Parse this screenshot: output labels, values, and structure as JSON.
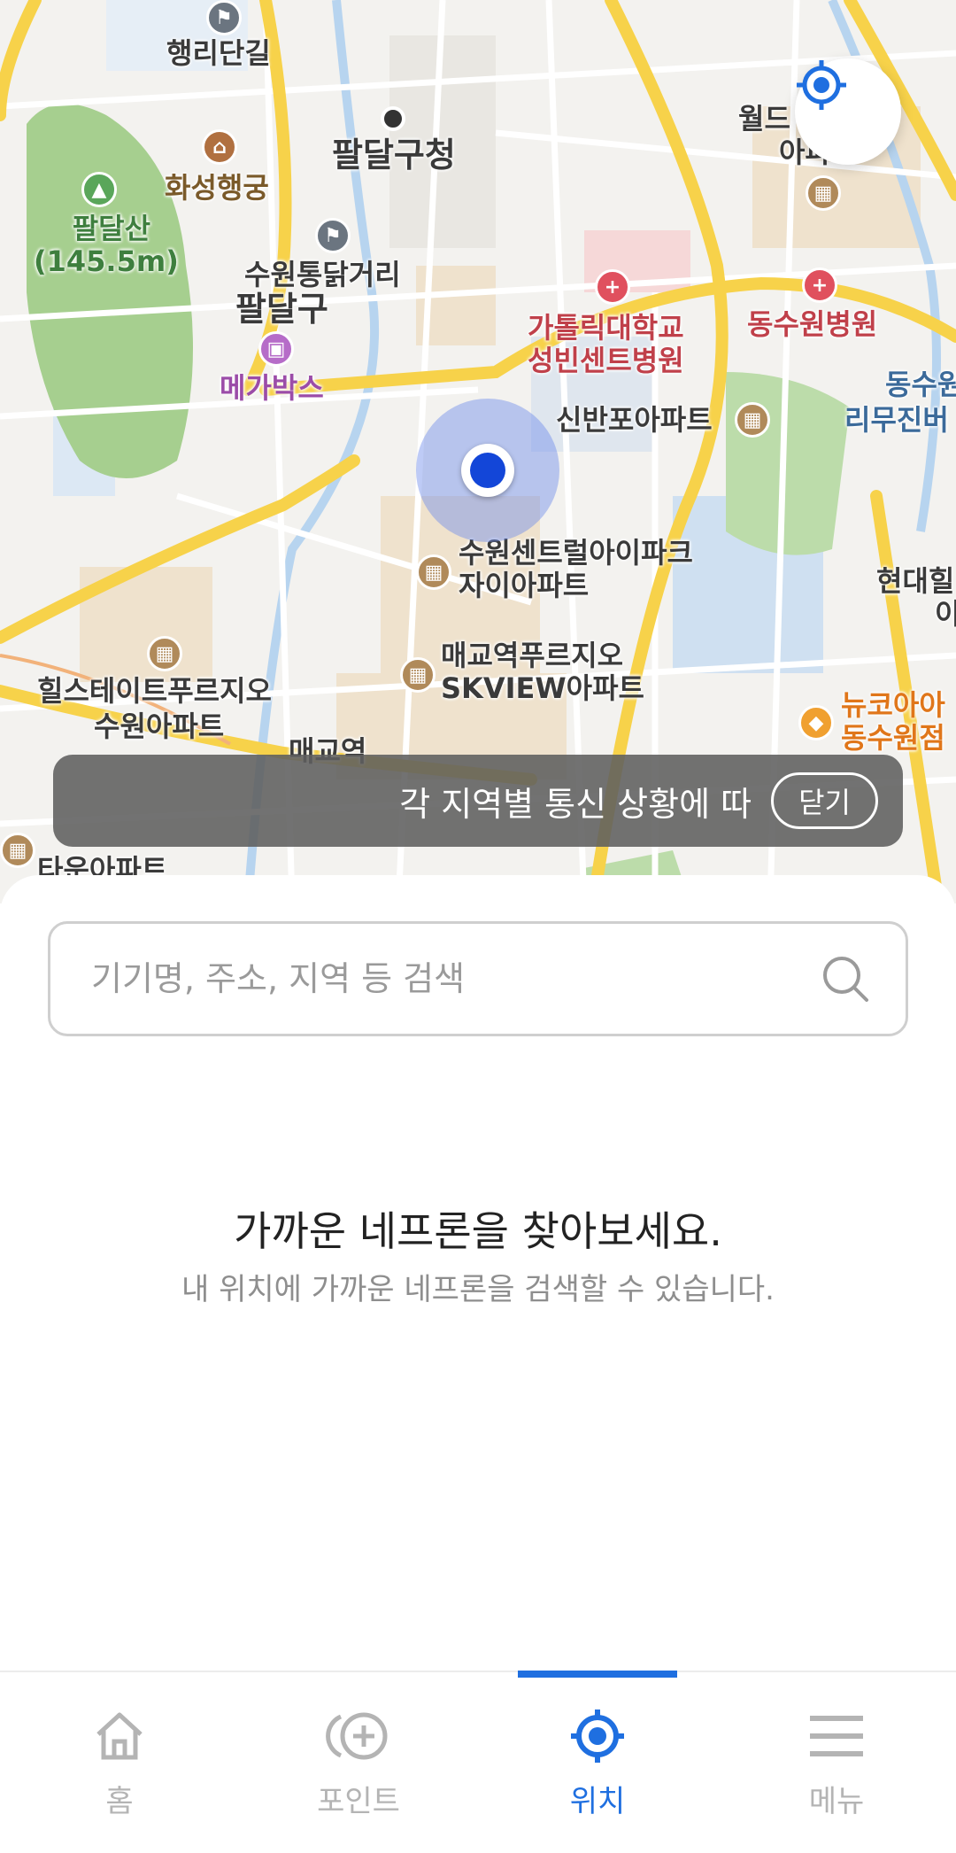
{
  "map": {
    "labels": {
      "haengridangil": "행리단길",
      "paldalgucheong": "팔달구청",
      "hwaseonghaenggung": "화성행궁",
      "paldalsan": "팔달산",
      "paldalsan_height": "(145.5m)",
      "suwontongdak": "수원통닭거리",
      "paldalgu": "팔달구",
      "megabox": "메가박스",
      "catholic_1": "가톨릭대학교",
      "catholic_2": "성빈센트병원",
      "dongsuwon_hosp": "동수원병원",
      "sinban_apt": "신반포아파트",
      "world_1": "월드",
      "world_2": "아파트",
      "dongsu_1": "동수원",
      "dongsu_2": "리무진버",
      "ipark_1": "수원센트럴아이파크",
      "ipark_2": "자이아파트",
      "hyundai_1": "현대힐",
      "hyundai_2": "이",
      "maegyo_1": "매교역푸르지오",
      "maegyo_2": "SKVIEW아파트",
      "hills_1": "힐스테이트푸르지오",
      "hills_2": "수원아파트",
      "maegyo_station": "매교역",
      "newcore_1": "뉴코아아",
      "newcore_2": "동수원점",
      "bottom_left": "타운아파트"
    }
  },
  "locate_button": {
    "icon": "crosshair-icon"
  },
  "toast": {
    "text": "각 지역별 통신 상황에 따",
    "close_label": "닫기"
  },
  "search": {
    "placeholder": "기기명, 주소, 지역 등 검색",
    "value": ""
  },
  "empty_state": {
    "title": "가까운 네프론을 찾아보세요.",
    "subtitle": "내 위치에 가까운 네프론을 검색할 수 있습니다."
  },
  "tabbar": {
    "active_color": "#1f6fe0",
    "tabs": [
      {
        "label": "홈",
        "icon": "home-icon"
      },
      {
        "label": "포인트",
        "icon": "points-icon"
      },
      {
        "label": "위치",
        "icon": "location-icon",
        "active": true
      },
      {
        "label": "메뉴",
        "icon": "menu-icon"
      }
    ]
  }
}
